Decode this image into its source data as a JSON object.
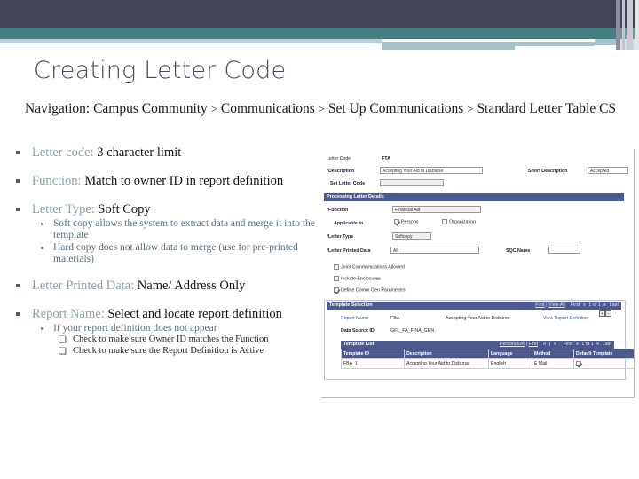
{
  "slide": {
    "title": "Creating Letter Code",
    "navigation": {
      "prefix": "Navigation:",
      "crumbs": [
        "Campus Community",
        "Communications",
        "Set Up Communications",
        "Standard Letter Table CS"
      ],
      "separator": ">",
      "full_text": "Navigation: Campus Community > Communications  > Set Up Communications > Standard Letter Table CS"
    },
    "bullets": [
      {
        "label": "Letter code:",
        "text": "3 character limit",
        "subs": []
      },
      {
        "label": "Function:",
        "text": "Match to owner ID in report definition",
        "subs": []
      },
      {
        "label": "Letter Type:",
        "text": "Soft Copy",
        "subs": [
          {
            "text": "Soft copy allows the system to extract data and merge it into the template",
            "subs": []
          },
          {
            "text": "Hard copy does not allow data to merge (use for pre-printed materials)",
            "subs": []
          }
        ]
      },
      {
        "label": "Letter Printed Data:",
        "text": "Name/ Address Only",
        "subs": []
      },
      {
        "label": "Report Name:",
        "text": "Select and locate report definition",
        "subs": [
          {
            "text": "If your report definition does not appear",
            "subs": [
              {
                "marker": "❑",
                "text": "Check to make sure Owner ID matches the Function"
              },
              {
                "marker": "❑",
                "text": "Check to make sure the Report Definition is Active"
              }
            ]
          }
        ]
      }
    ]
  },
  "screenshot": {
    "header_fields": {
      "letter_code_label": "Letter Code",
      "letter_code_value": "FTA",
      "description_label": "*Description",
      "description_value": "Accepting Your Aid to Disburse",
      "short_description_label": "Short Description",
      "short_description_value": "AccepAid",
      "set_letter_code_label": "Set Letter Code",
      "set_letter_code_value": ""
    },
    "processing": {
      "section_title": "Processing Letter Details",
      "function_label": "*Function",
      "function_value": "Financial Aid",
      "applicable_label": "Applicable to",
      "persons_label": "Persons",
      "persons_checked": true,
      "organization_label": "Organization",
      "organization_checked": false,
      "letter_type_label": "*Letter Type",
      "letter_type_value": "Softcopy",
      "printed_data_label": "*Letter Printed Data",
      "printed_data_value": "All",
      "sqc_name_label": "SQC Name",
      "sqc_name_value": "",
      "checks": [
        {
          "label": "Joint Communications Allowed",
          "checked": false
        },
        {
          "label": "Include Enclosures",
          "checked": false
        },
        {
          "label": "Define Comm Gen Parameters",
          "checked": true
        }
      ]
    },
    "template_selection": {
      "section_title": "Template Selection",
      "find_label": "Find",
      "view_all_label": "View All",
      "first_label": "First",
      "counter_label": "1 of 1",
      "last_label": "Last",
      "report_name_label": "Report Name",
      "report_name_value": "FBA",
      "report_desc_value": "Accepting Your Aid to Disburse",
      "view_report_definition_label": "View Report Definition",
      "add_button": "+",
      "remove_button": "−",
      "data_source_label": "Data Source ID",
      "data_source_value": "GFL_FA_FINA_GEN"
    },
    "template_list": {
      "section_title": "Template List",
      "personalize_label": "Personalize",
      "find_label": "Find",
      "first_label": "First",
      "counter_label": "1 of 1",
      "last_label": "Last",
      "columns": [
        "Template ID",
        "Description",
        "Language",
        "Method",
        "Default Template"
      ],
      "rows": [
        {
          "template_id": "FBA_1",
          "description": "Accepting Your Aid to Disburse",
          "language": "English",
          "method": "E Mail",
          "default_template": true
        }
      ]
    }
  },
  "theme": {
    "band_dark": "#434455",
    "band_teal": "#437f82",
    "band_light": "#a3c4cb",
    "title_color": "#464a5b",
    "label_color": "#8fa2ab",
    "bullet_marker": "#6f4a6f",
    "section_bar": "#4d5a8e"
  }
}
